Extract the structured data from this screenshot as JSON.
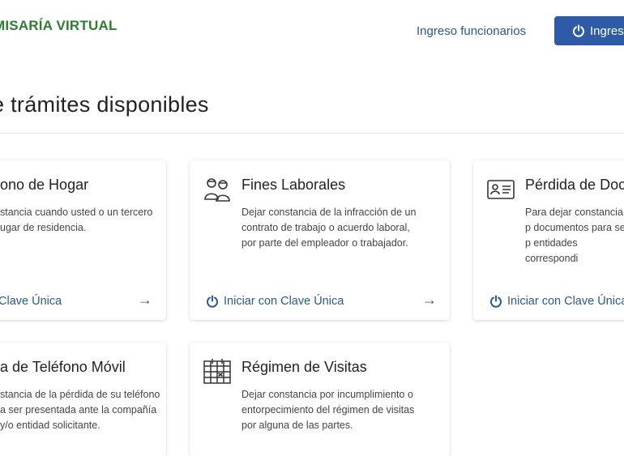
{
  "header": {
    "brand": "MISARÍA VIRTUAL",
    "funcionarios_link": "Ingreso funcionarios",
    "login_button": "Ingreso"
  },
  "section": {
    "title": "e trámites disponibles"
  },
  "cards": [
    {
      "title": "ono de Hogar",
      "description": "stancia cuando usted o un tercero\nugar de residencia.",
      "action": "Clave Única",
      "arrow": "→",
      "icon": "home-phone-icon"
    },
    {
      "title": "Fines Laborales",
      "description": "Dejar constancia de la infracción de un contrato de trabajo o acuerdo laboral, por parte del empleador o trabajador.",
      "action": "Iniciar con Clave Única",
      "arrow": "→",
      "icon": "workers-icon"
    },
    {
      "title": "Pérdida de Doc",
      "description": "Para dejar constancia p documentos para ser p entidades correspondi",
      "action": "Iniciar con Clave Única",
      "icon": "id-card-icon"
    },
    {
      "title": "a de Teléfono Móvil",
      "description": "stancia de la pérdida de su teléfono\na ser presentada ante la compañía\ny/o entidad solicitante.",
      "icon": "mobile-phone-icon"
    },
    {
      "title": "Régimen de Visitas",
      "description": "Dejar constancia por incumplimiento o entorpecimiento del régimen de visitas por alguna de las partes.",
      "icon": "calendar-icon"
    }
  ],
  "colors": {
    "brand": "#2e7d32",
    "primary": "#2f5aa8",
    "link": "#2a5a8c"
  }
}
